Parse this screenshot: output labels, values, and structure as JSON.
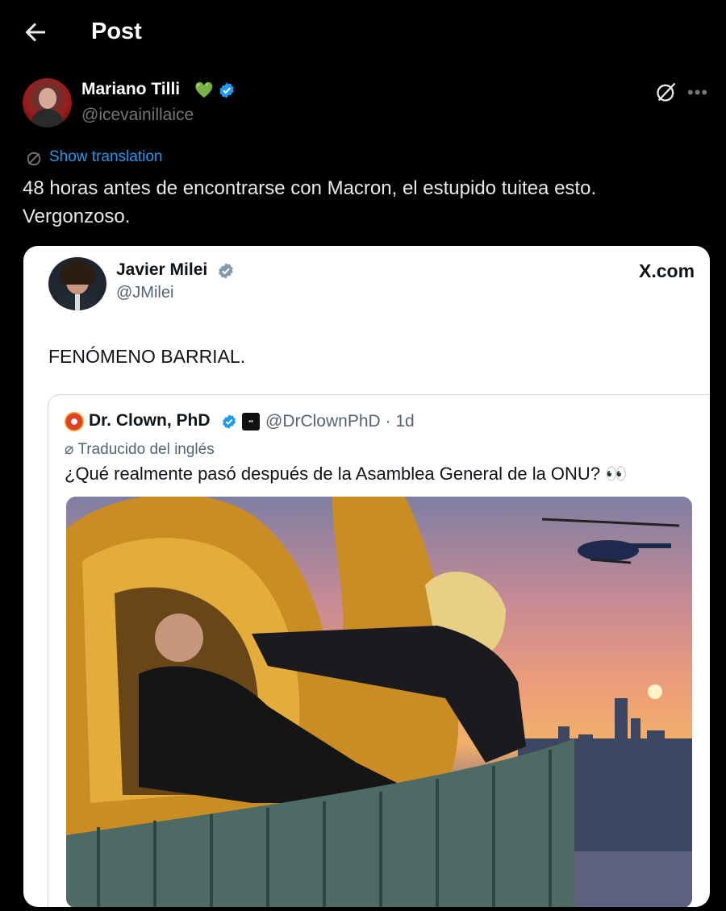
{
  "header": {
    "title": "Post"
  },
  "author": {
    "name": "Mariano Tilli",
    "name_emoji": "💚",
    "handle": "@icevainillaice"
  },
  "translation": {
    "label": "Show translation"
  },
  "post": {
    "line1": "48 horas antes de encontrarse con Macron, el estupido tuitea esto.",
    "line2": "Vergonzoso."
  },
  "embed": {
    "name": "Javier Milei",
    "handle": "@JMilei",
    "source": "X.com",
    "text": "FENÓMENO BARRIAL.",
    "quote": {
      "name": "Dr. Clown, PhD",
      "handle_time": "@DrClownPhD · 1d",
      "translated_label": "Traducido del inglés",
      "text": "¿Qué realmente pasó después de la Asamblea General de la ONU? 👀"
    }
  },
  "colors": {
    "accent": "#1d9bf0",
    "verified_gold_blue": "#1d9bf0",
    "verified_gray": "#829aab",
    "background": "#000000"
  },
  "icons": {
    "back": "back-arrow-icon",
    "grok": "grok-icon",
    "more": "more-icon",
    "translate": "translate-icon"
  }
}
